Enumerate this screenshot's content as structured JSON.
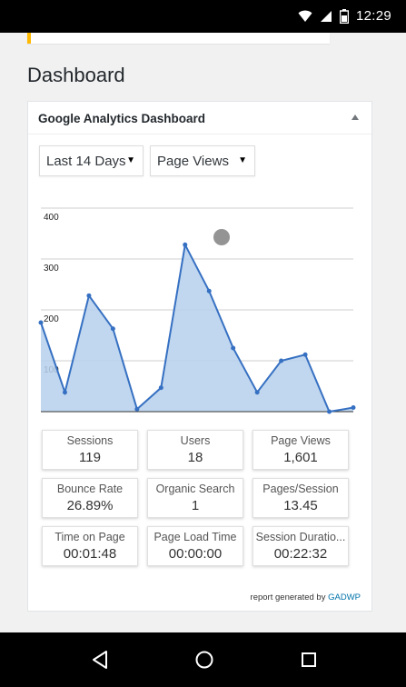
{
  "status_bar": {
    "time": "12:29",
    "icons": [
      "wifi-icon",
      "signal-icon",
      "battery-icon"
    ]
  },
  "page": {
    "title": "Dashboard"
  },
  "widget": {
    "title": "Google Analytics Dashboard",
    "range_select": {
      "selected": "Last 14 Days"
    },
    "metric_select": {
      "selected": "Page Views"
    },
    "footer": {
      "prefix": "report generated by",
      "link": "GADWP"
    }
  },
  "chart_data": {
    "type": "area",
    "xlabel": "",
    "ylabel": "",
    "ylim": [
      0,
      400
    ],
    "yticks": [
      "400",
      "300",
      "200",
      "100"
    ],
    "grid": true,
    "series": [
      {
        "values": [
          175,
          38,
          228,
          163,
          5,
          47,
          328,
          237,
          125,
          38,
          100,
          112,
          0,
          8
        ]
      }
    ],
    "colors": {
      "line": "#3670c2",
      "fill": "#b6d0ec"
    }
  },
  "stats": [
    {
      "label": "Sessions",
      "value": "119"
    },
    {
      "label": "Users",
      "value": "18"
    },
    {
      "label": "Page Views",
      "value": "1,601"
    },
    {
      "label": "Bounce Rate",
      "value": "26.89%"
    },
    {
      "label": "Organic Search",
      "value": "1"
    },
    {
      "label": "Pages/Session",
      "value": "13.45"
    },
    {
      "label": "Time on Page",
      "value": "00:01:48"
    },
    {
      "label": "Page Load Time",
      "value": "00:00:00"
    },
    {
      "label": "Session Duratio...",
      "value": "00:22:32"
    }
  ],
  "nav_bar": {
    "buttons": [
      "back-icon",
      "home-icon",
      "recents-icon"
    ]
  }
}
